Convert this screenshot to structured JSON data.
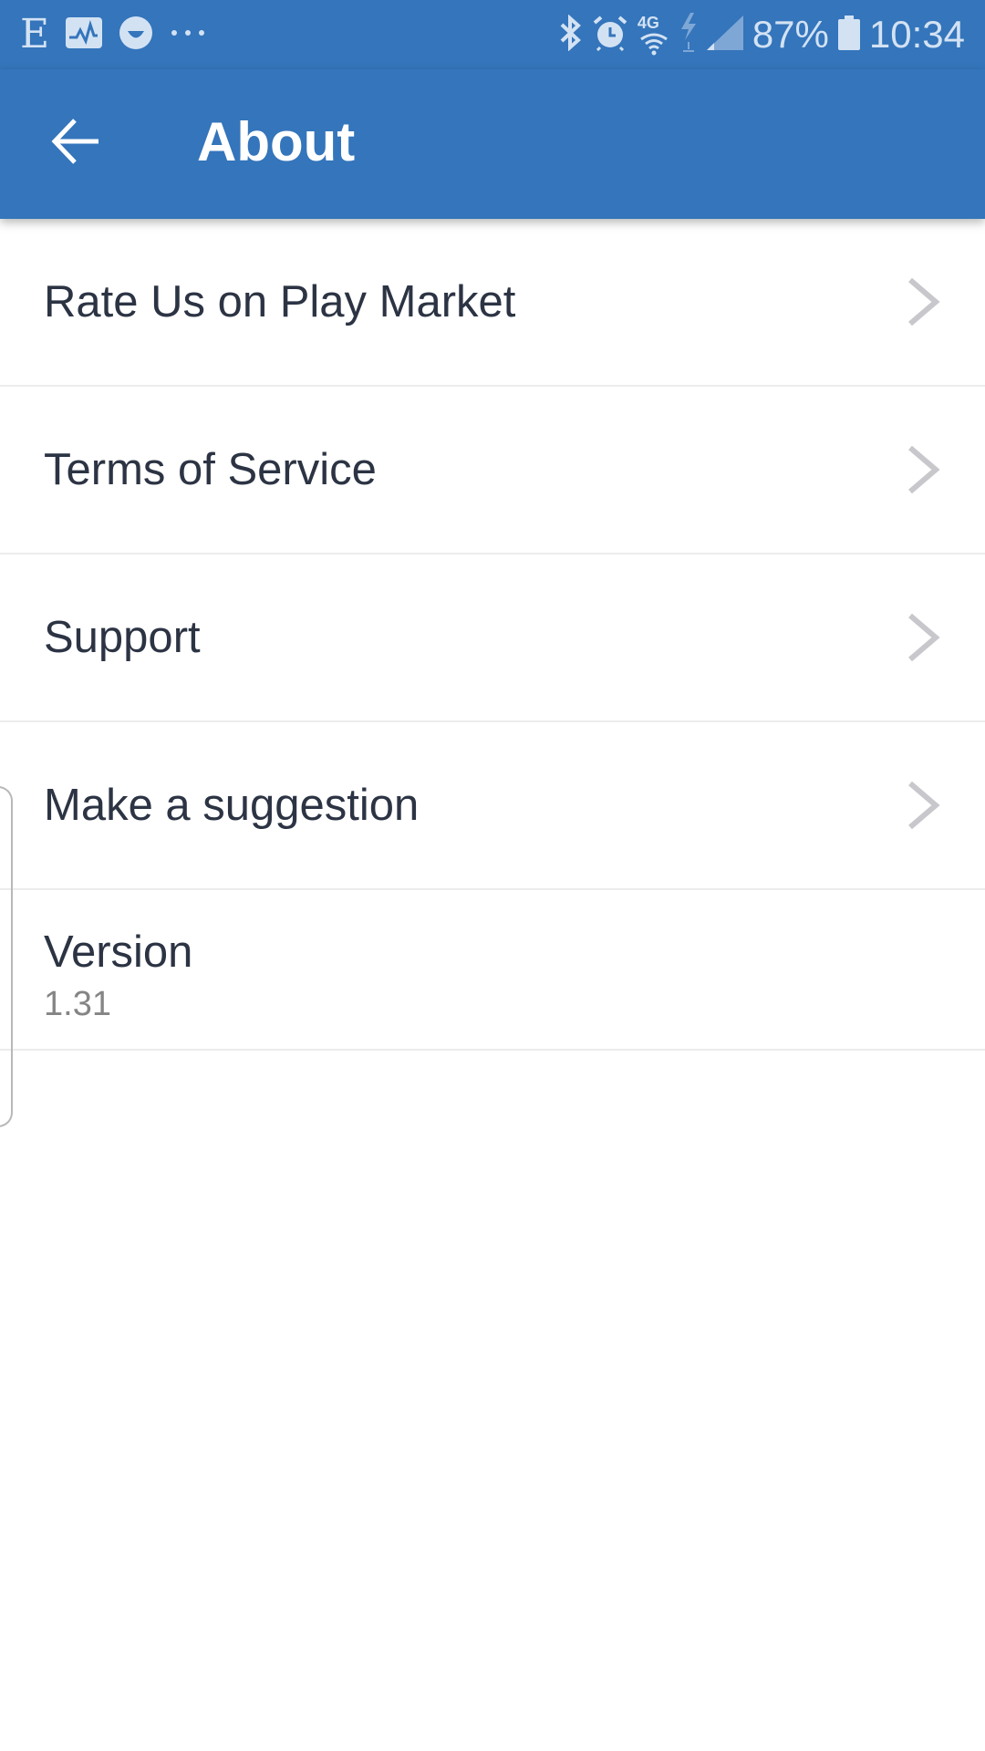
{
  "status_bar": {
    "left_icons": [
      "e-letter-icon",
      "pulse-monitor-icon",
      "smiley-icon",
      "more-dots-icon"
    ],
    "e_letter": "E",
    "more_dots": "···",
    "right_icons": [
      "bluetooth-icon",
      "alarm-icon",
      "4g-wifi-icon",
      "charging-bolt-icon",
      "signal-icon",
      "battery-icon"
    ],
    "network_label": "4G",
    "battery_percent": "87%",
    "time": "10:34"
  },
  "app_bar": {
    "title": "About",
    "back_icon": "arrow-left-icon",
    "background_color": "#3475bb"
  },
  "menu": {
    "items": [
      {
        "label": "Rate Us on Play Market",
        "icon": "chevron-right-icon"
      },
      {
        "label": "Terms of Service",
        "icon": "chevron-right-icon"
      },
      {
        "label": "Support",
        "icon": "chevron-right-icon"
      },
      {
        "label": "Make a suggestion",
        "icon": "chevron-right-icon"
      }
    ],
    "version": {
      "label": "Version",
      "value": "1.31"
    }
  }
}
